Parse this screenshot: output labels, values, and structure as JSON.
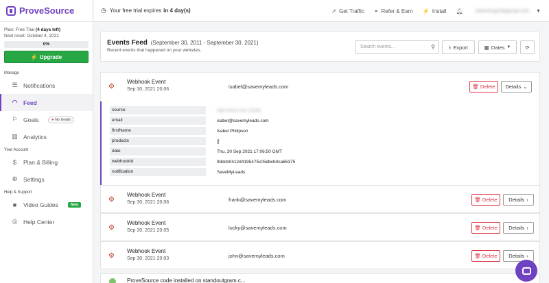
{
  "brand": {
    "name": "ProveSource"
  },
  "plan": {
    "plan_label": "Plan:",
    "plan_value": "Free Trial",
    "plan_extra": "(4 days left)",
    "reset_label": "Next reset:",
    "reset_value": "October 4, 2021",
    "progress_text": "0%",
    "progress_fraction": 0,
    "upgrade_label": "Upgrade"
  },
  "sidebar": {
    "manage_label": "Manage",
    "account_label": "Your Account",
    "help_label": "Help & Support",
    "items": [
      {
        "label": "Notifications",
        "icon": "list-icon"
      },
      {
        "label": "Feed",
        "icon": "rss-icon",
        "active": true
      },
      {
        "label": "Goals",
        "icon": "flag-icon",
        "badge": "No Goals"
      },
      {
        "label": "Analytics",
        "icon": "bar-chart-icon"
      },
      {
        "label": "Plan & Billing",
        "icon": "dollar-icon"
      },
      {
        "label": "Settings",
        "icon": "gear-icon"
      },
      {
        "label": "Video Guides",
        "icon": "video-icon",
        "badge": "New"
      },
      {
        "label": "Help Center",
        "icon": "lifebuoy-icon"
      }
    ]
  },
  "topbar": {
    "trial_text": "Your free trial expires",
    "trial_bold": "in 4 day(s)",
    "links": [
      "Get Traffic",
      "Refer & Earn",
      "Install"
    ],
    "user_email": "sitetesting23@gmail.com"
  },
  "feed": {
    "title": "Events Feed",
    "range": "(September 30, 2011 - September 30, 2021)",
    "subtitle": "Recent events that happened on your websites.",
    "search_placeholder": "Search events...",
    "export_label": "Export",
    "dates_label": "Dates",
    "delete_label": "Delete",
    "details_label": "Details",
    "events": [
      {
        "title": "Webhook Event",
        "time": "Sep 30, 2021 20:06",
        "email": "isabel@savemyleads.com",
        "expanded": true
      },
      {
        "title": "Webhook Event",
        "time": "Sep 30, 2021 20:06",
        "email": "frank@savemyleads.com"
      },
      {
        "title": "Webhook Event",
        "time": "Sep 30, 2021 20:05",
        "email": "lucky@savemyleads.com"
      },
      {
        "title": "Webhook Event",
        "time": "Sep 30, 2021 20:03",
        "email": "john@savemyleads.com"
      }
    ],
    "details": [
      {
        "key": "source",
        "value": "Apix-Drive.com (1126)",
        "blurred": true
      },
      {
        "key": "email",
        "value": "isabel@savemyleads.com"
      },
      {
        "key": "firstName",
        "value": "Isabel Philipson"
      },
      {
        "key": "products",
        "value": "[]"
      },
      {
        "key": "date",
        "value": "Thu, 30 Sep 2021 17:06:50 GMT"
      },
      {
        "key": "webhookId",
        "value": "9ddcb0412d4195475c05dbcb0ca66375"
      },
      {
        "key": "notification",
        "value": "SaveMyLeads"
      }
    ],
    "last_event": "ProveSource code installed on standoutgram.c..."
  }
}
